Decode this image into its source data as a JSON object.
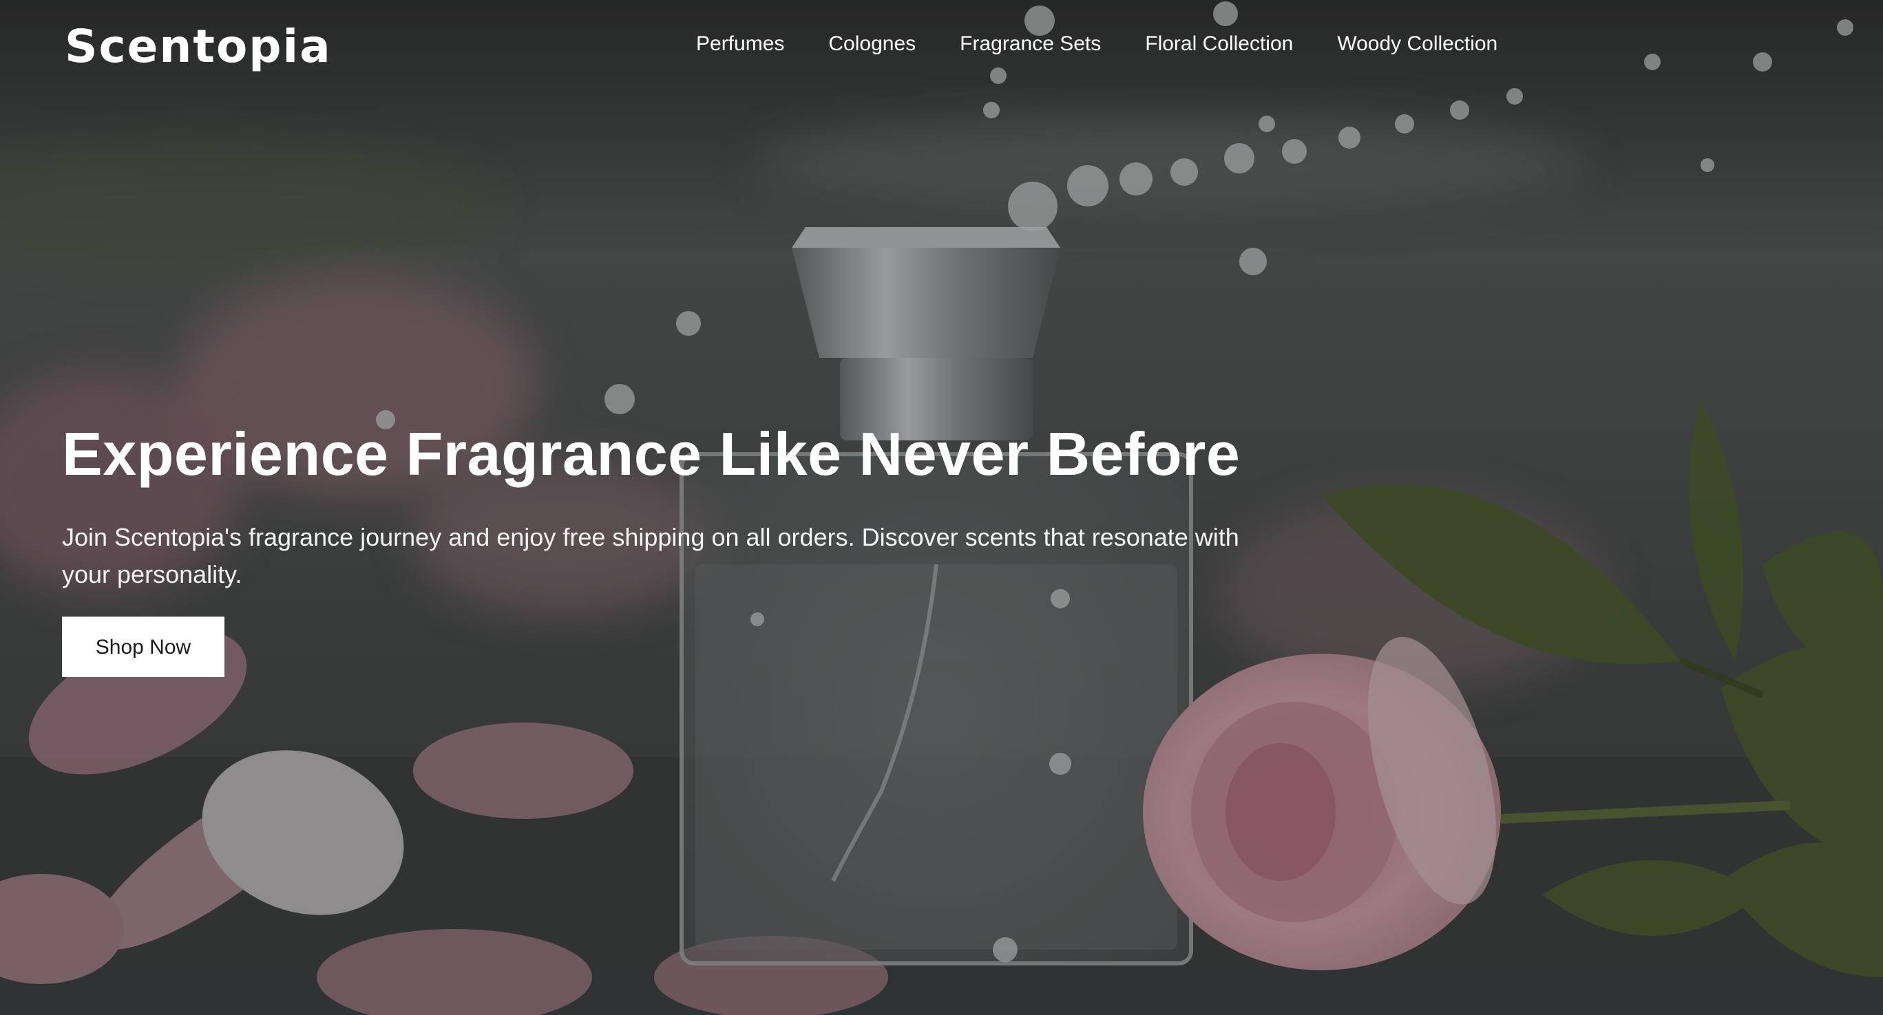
{
  "header": {
    "logo_text": "Scentopia",
    "nav": [
      {
        "label": "Perfumes"
      },
      {
        "label": "Colognes"
      },
      {
        "label": "Fragrance Sets"
      },
      {
        "label": "Floral Collection"
      },
      {
        "label": "Woody Collection"
      }
    ]
  },
  "hero": {
    "headline": "Experience Fragrance Like Never Before",
    "subtext": "Join Scentopia's fragrance journey and enjoy free shipping on all orders. Discover scents that resonate with your personality.",
    "cta_label": "Shop Now"
  },
  "colors": {
    "overlay_dark": "#2a2d2e",
    "text": "#ffffff",
    "button_bg": "#ffffff",
    "button_text": "#1a1a1a",
    "rose_pink": "#e8b5c0",
    "leaf_green": "#4b5e2c"
  }
}
